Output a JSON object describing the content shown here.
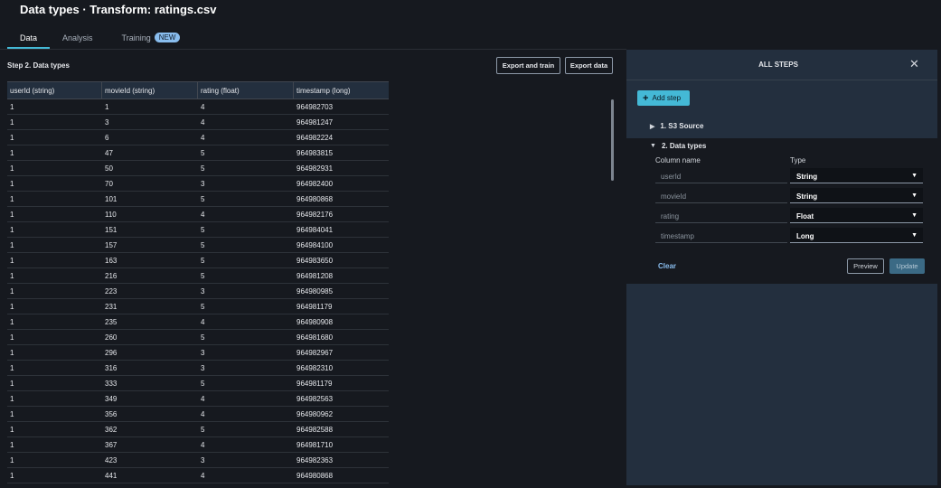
{
  "header": {
    "title": "Data types · Transform: ratings.csv"
  },
  "tabs": [
    {
      "label": "Data"
    },
    {
      "label": "Analysis"
    },
    {
      "label": "Training",
      "badge": "NEW"
    }
  ],
  "main": {
    "step_label": "Step 2. Data types",
    "export_train_label": "Export and train",
    "export_data_label": "Export data",
    "columns": [
      "userId (string)",
      "movieId (string)",
      "rating (float)",
      "timestamp (long)"
    ],
    "rows": [
      [
        "1",
        "1",
        "4",
        "964982703"
      ],
      [
        "1",
        "3",
        "4",
        "964981247"
      ],
      [
        "1",
        "6",
        "4",
        "964982224"
      ],
      [
        "1",
        "47",
        "5",
        "964983815"
      ],
      [
        "1",
        "50",
        "5",
        "964982931"
      ],
      [
        "1",
        "70",
        "3",
        "964982400"
      ],
      [
        "1",
        "101",
        "5",
        "964980868"
      ],
      [
        "1",
        "110",
        "4",
        "964982176"
      ],
      [
        "1",
        "151",
        "5",
        "964984041"
      ],
      [
        "1",
        "157",
        "5",
        "964984100"
      ],
      [
        "1",
        "163",
        "5",
        "964983650"
      ],
      [
        "1",
        "216",
        "5",
        "964981208"
      ],
      [
        "1",
        "223",
        "3",
        "964980985"
      ],
      [
        "1",
        "231",
        "5",
        "964981179"
      ],
      [
        "1",
        "235",
        "4",
        "964980908"
      ],
      [
        "1",
        "260",
        "5",
        "964981680"
      ],
      [
        "1",
        "296",
        "3",
        "964982967"
      ],
      [
        "1",
        "316",
        "3",
        "964982310"
      ],
      [
        "1",
        "333",
        "5",
        "964981179"
      ],
      [
        "1",
        "349",
        "4",
        "964982563"
      ],
      [
        "1",
        "356",
        "4",
        "964980962"
      ],
      [
        "1",
        "362",
        "5",
        "964982588"
      ],
      [
        "1",
        "367",
        "4",
        "964981710"
      ],
      [
        "1",
        "423",
        "3",
        "964982363"
      ],
      [
        "1",
        "441",
        "4",
        "964980868"
      ]
    ]
  },
  "panel": {
    "title": "ALL STEPS",
    "add_step_label": "Add step",
    "steps": [
      {
        "label": "1. S3 Source",
        "expanded": false
      },
      {
        "label": "2. Data types",
        "expanded": true
      }
    ],
    "column_name_header": "Column name",
    "type_header": "Type",
    "fields": [
      {
        "name": "userId",
        "type": "String"
      },
      {
        "name": "movieId",
        "type": "String"
      },
      {
        "name": "rating",
        "type": "Float"
      },
      {
        "name": "timestamp",
        "type": "Long"
      }
    ],
    "clear_label": "Clear",
    "preview_label": "Preview",
    "update_label": "Update"
  },
  "colors": {
    "accent": "#44b9d6",
    "panel_bg": "#232f3e",
    "page_bg": "#16191f",
    "link": "#89bdee"
  }
}
